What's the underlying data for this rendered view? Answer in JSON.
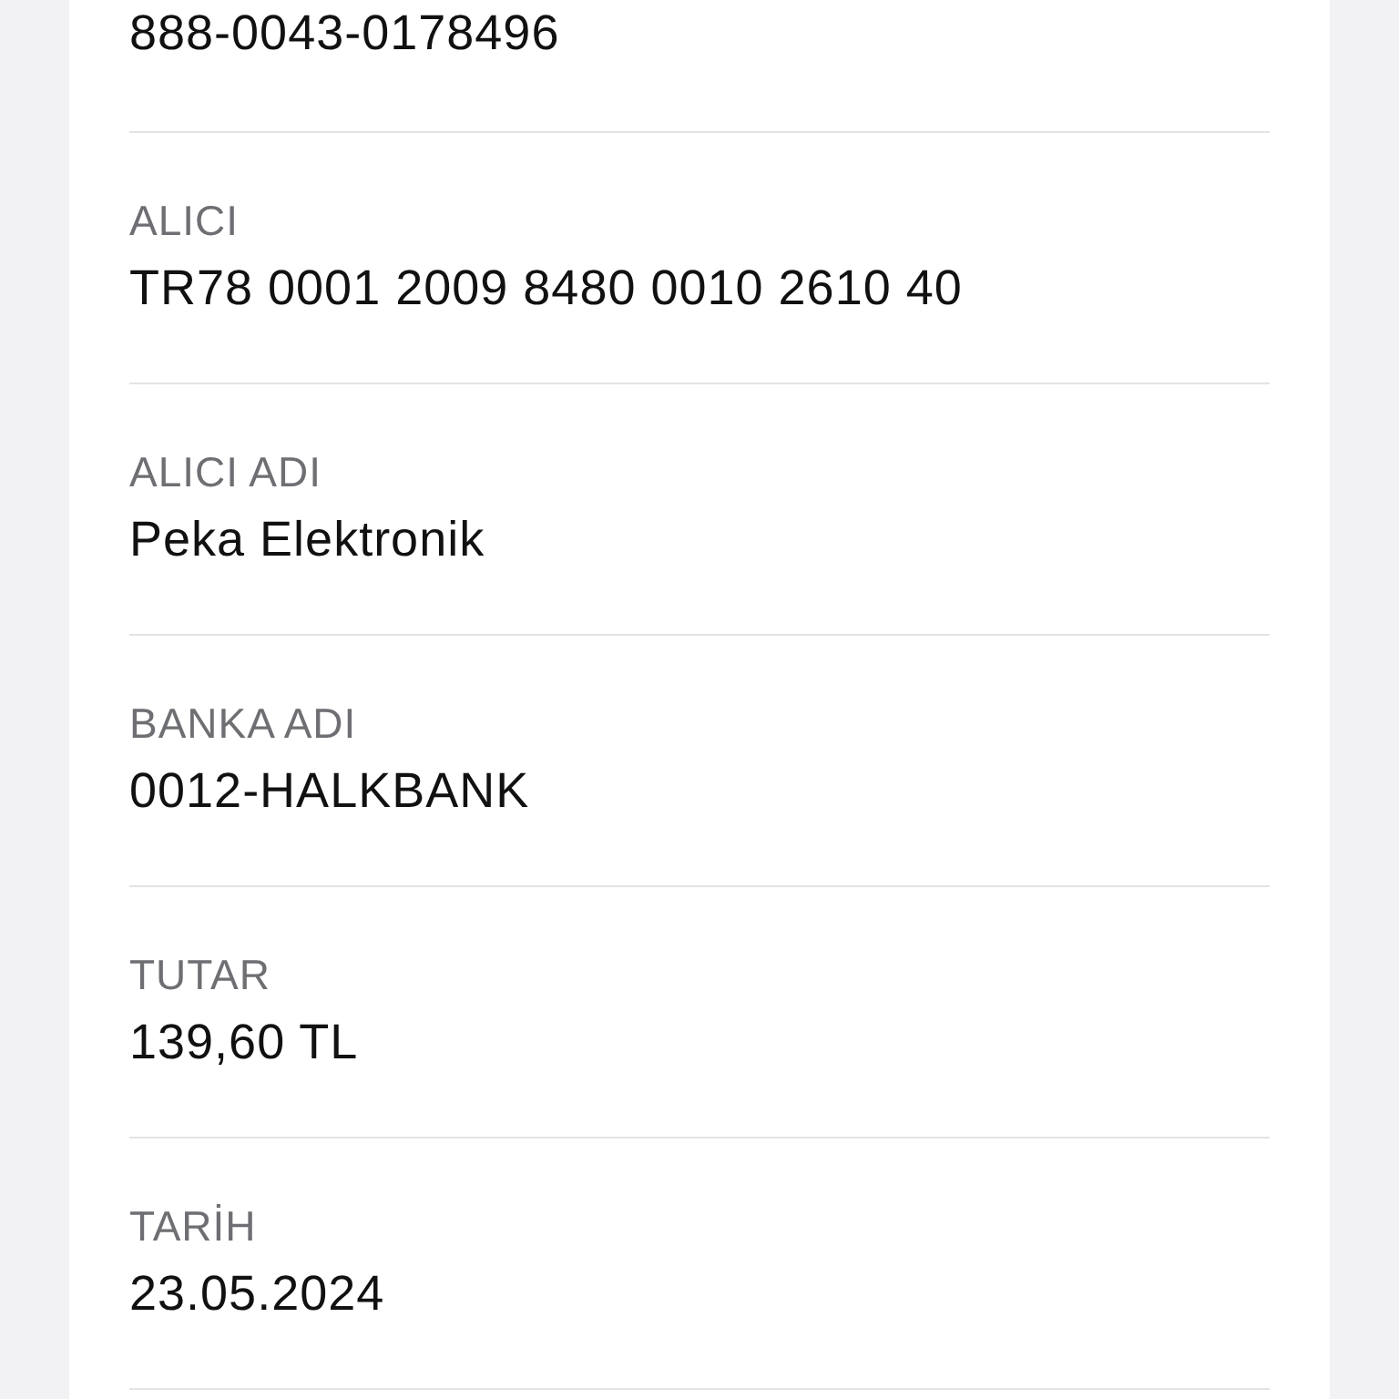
{
  "fields": [
    {
      "value": "888-0043-0178496"
    },
    {
      "label": "ALICI",
      "value": "TR78 0001 2009 8480 0010 2610 40"
    },
    {
      "label": "ALICI ADI",
      "value": "Peka Elektronik"
    },
    {
      "label": "BANKA ADI",
      "value": "0012-HALKBANK"
    },
    {
      "label": "TUTAR",
      "value": "139,60 TL"
    },
    {
      "label": "TARİH",
      "value": "23.05.2024"
    }
  ]
}
